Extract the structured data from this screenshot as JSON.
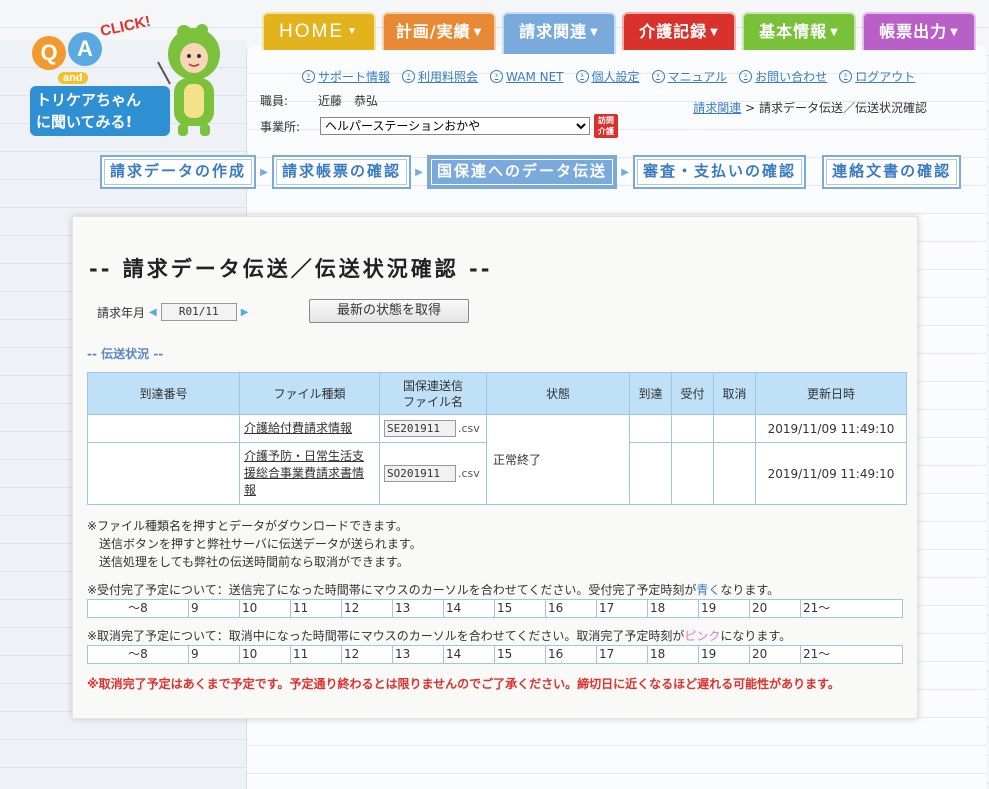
{
  "logo": {
    "q": "Q",
    "a": "A",
    "click": "CLICK!",
    "and": "and",
    "line1": "トリケアちゃん",
    "line2": "に聞いてみる!"
  },
  "tabs": [
    {
      "label": "HOME",
      "color": "#e3b31d"
    },
    {
      "label": "計画/実績",
      "color": "#e88a35"
    },
    {
      "label": "請求関連",
      "color": "#7aa9dc"
    },
    {
      "label": "介護記録",
      "color": "#d9322c"
    },
    {
      "label": "基本情報",
      "color": "#7ac13a"
    },
    {
      "label": "帳票出力",
      "color": "#b85fc8"
    }
  ],
  "tab_arrow": "▼",
  "util_links": [
    "サポート情報",
    "利用料照会",
    "WAM NET",
    "個人設定",
    "マニュアル",
    "お問い合わせ",
    "ログアウト"
  ],
  "staff": {
    "label": "職員:",
    "name": "近藤　恭弘"
  },
  "office": {
    "label": "事業所:",
    "value": "ヘルパーステーションおかや",
    "badge_line1": "訪問",
    "badge_line2": "介護"
  },
  "breadcrumb": {
    "parent": "請求関連",
    "sep": ">",
    "current": "請求データ伝送／伝送状況確認"
  },
  "subnav": [
    {
      "label": "請求データの作成",
      "active": false
    },
    {
      "label": "請求帳票の確認",
      "active": false
    },
    {
      "label": "国保連へのデータ伝送",
      "active": true
    },
    {
      "label": "審査・支払いの確認",
      "active": false
    },
    {
      "label": "連絡文書の確認",
      "active": false
    }
  ],
  "subnav_sep": "▶",
  "main": {
    "title": "-- 請求データ伝送／伝送状況確認 --",
    "ym_label": "請求年月",
    "ym_value": "R01/11",
    "ym_prev": "◀",
    "ym_next": "▶",
    "refresh_label": "最新の状態を取得",
    "section_title": "-- 伝送状況 --"
  },
  "table": {
    "headers": [
      "到達番号",
      "ファイル種類",
      "国保連送信\nファイル名",
      "状態",
      "到達",
      "受付",
      "取消",
      "更新日時"
    ],
    "header_fname_line1": "国保連送信",
    "header_fname_line2": "ファイル名",
    "rows": [
      {
        "arrival": "",
        "ftype": "介護給付費請求情報",
        "fname": "SE201911",
        "ext": ".csv",
        "state": "正常終了",
        "reach": "",
        "accept": "",
        "cancel": "",
        "updated": "2019/11/09 11:49:10"
      },
      {
        "arrival": "",
        "ftype": "介護予防・日常生活支援総合事業費請求書情報",
        "fname": "SO201911",
        "ext": ".csv",
        "state": "",
        "reach": "",
        "accept": "",
        "cancel": "",
        "updated": "2019/11/09 11:49:10"
      }
    ]
  },
  "notes": {
    "line1": "※ファイル種類名を押すとデータがダウンロードできます。",
    "line2": "送信ボタンを押すと弊社サーバに伝送データが送られます。",
    "line3": "送信処理をしても弊社の伝送時間前なら取消ができます。"
  },
  "accept_note": {
    "before": "※受付完了予定について：送信完了になった時間帯にマウスのカーソルを合わせてください。受付完了予定時刻が",
    "colored": "青く",
    "after": "なります。"
  },
  "cancel_note": {
    "before": "※取消完了予定について：取消中になった時間帯にマウスのカーソルを合わせてください。取消完了予定時刻が",
    "colored": "ピンク",
    "after": "になります。"
  },
  "hours": [
    "～8",
    "9",
    "10",
    "11",
    "12",
    "13",
    "14",
    "15",
    "16",
    "17",
    "18",
    "19",
    "20",
    "21～"
  ],
  "warning": "※取消完了予定はあくまで予定です。予定通り終わるとは限りませんのでご了承ください。締切日に近くなるほど遅れる可能性があります。"
}
